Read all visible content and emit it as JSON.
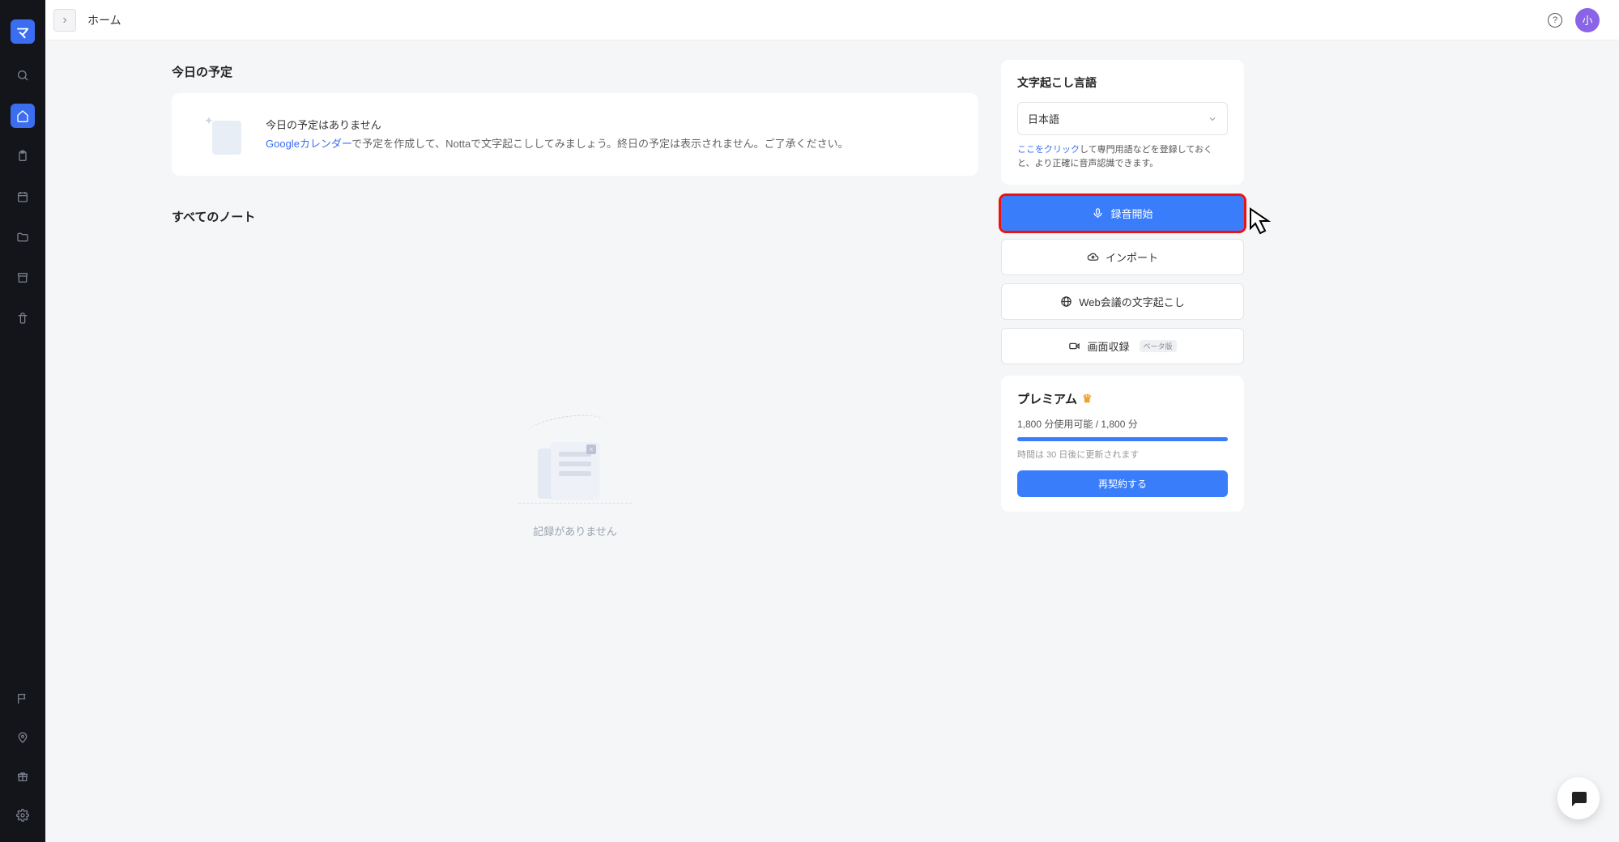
{
  "header": {
    "title": "ホーム",
    "avatar_label": "小"
  },
  "schedule": {
    "section_title": "今日の予定",
    "line1": "今日の予定はありません",
    "link_text": "Googleカレンダー",
    "line2_rest": "で予定を作成して、Nottaで文字起こししてみましょう。終日の予定は表示されません。ご了承ください。"
  },
  "notes": {
    "section_title": "すべてのノート",
    "empty_text": "記録がありません"
  },
  "transcribe_card": {
    "title": "文字起こし言語",
    "selected_language": "日本語",
    "hint_link": "ここをクリック",
    "hint_rest": "して専門用語などを登録しておくと、より正確に音声認識できます。"
  },
  "actions": {
    "record": "録音開始",
    "import_label": "インポート",
    "web_meeting": "Web会議の文字起こし",
    "screen_record": "画面収録",
    "beta_badge": "ベータ版"
  },
  "premium": {
    "title": "プレミアム",
    "usage_text": "1,800 分使用可能 / 1,800 分",
    "note": "時間は 30 日後に更新されます",
    "renew_label": "再契約する"
  }
}
